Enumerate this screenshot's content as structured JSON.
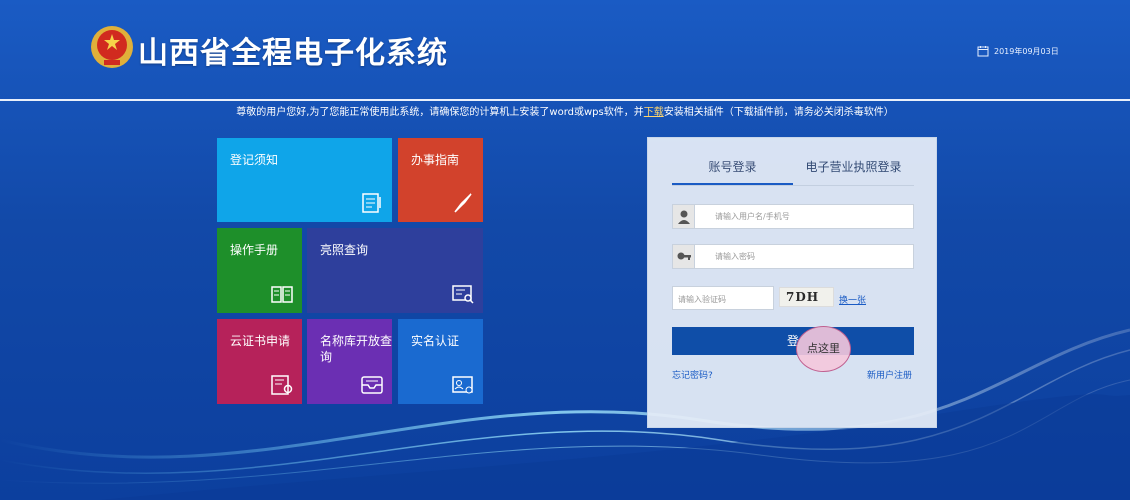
{
  "header": {
    "title": "山西省全程电子化系统",
    "date": "2019年09月03日",
    "emblem_icon": "national-emblem-icon",
    "calendar_icon": "calendar-icon"
  },
  "notice": {
    "before": "尊敬的用户您好,为了您能正常使用此系统，请确保您的计算机上安装了word或wps软件，并",
    "link": "下载",
    "after": "安装相关插件（下载插件前，请务必关闭杀毒软件）"
  },
  "tiles": [
    {
      "label": "登记须知",
      "icon": "notebook-icon",
      "color": "#0fa5e9"
    },
    {
      "label": "办事指南",
      "icon": "compass-icon",
      "color": "#d2422c"
    },
    {
      "label": "操作手册",
      "icon": "book-icon",
      "color": "#1e8f2a"
    },
    {
      "label": "亮照查询",
      "icon": "license-search-icon",
      "color": "#2e3f9c"
    },
    {
      "label": "云证书申请",
      "icon": "certificate-icon",
      "color": "#b6225a"
    },
    {
      "label": "名称库开放查询",
      "icon": "inbox-icon",
      "color": "#6b2fb3"
    },
    {
      "label": "实名认证",
      "icon": "id-card-icon",
      "color": "#1a6ad0"
    }
  ],
  "login": {
    "tabs": [
      "账号登录",
      "电子营业执照登录"
    ],
    "username_placeholder": "请输入用户名/手机号",
    "password_placeholder": "请输入密码",
    "captcha_placeholder": "请输入验证码",
    "captcha_text": "7DH",
    "change_link": "换一张",
    "login_label": "登",
    "forgot": "忘记密码?",
    "register": "新用户注册"
  },
  "bubble": {
    "label": "点这里"
  },
  "colors": {
    "primary": "#1a5bc4",
    "button": "#0f4ea8",
    "link": "#1a5bc4"
  }
}
